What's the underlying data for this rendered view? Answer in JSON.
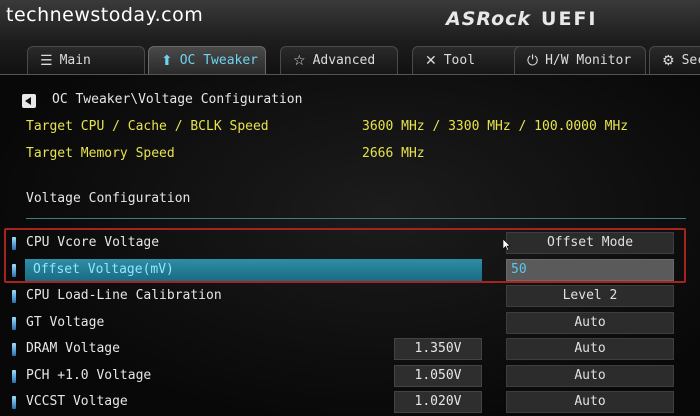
{
  "watermark": "technewstoday.com",
  "brand": {
    "name": "ASRock",
    "product": "UEFI"
  },
  "tabs": [
    {
      "label": "Main",
      "icon": "list-icon",
      "active": false
    },
    {
      "label": "OC Tweaker",
      "icon": "rocket-icon",
      "active": true
    },
    {
      "label": "Advanced",
      "icon": "star-icon",
      "active": false
    },
    {
      "label": "Tool",
      "icon": "tools-icon",
      "active": false
    },
    {
      "label": "H/W Monitor",
      "icon": "power-icon",
      "active": false
    },
    {
      "label": "Secu",
      "icon": "lock-icon",
      "active": false
    }
  ],
  "breadcrumb": "OC Tweaker\\Voltage Configuration",
  "info": [
    {
      "label": "Target CPU / Cache / BCLK Speed",
      "value": "3600 MHz / 3300 MHz / 100.0000 MHz"
    },
    {
      "label": "Target Memory Speed",
      "value": "2666 MHz"
    }
  ],
  "section_title": "Voltage Configuration",
  "settings": [
    {
      "label": "CPU Vcore Voltage",
      "value": "Offset Mode",
      "voltage": ""
    },
    {
      "label": "Offset Voltage(mV)",
      "value": "50",
      "voltage": ""
    },
    {
      "label": "CPU Load-Line Calibration",
      "value": "Level 2",
      "voltage": ""
    },
    {
      "label": "GT Voltage",
      "value": "Auto",
      "voltage": ""
    },
    {
      "label": "DRAM Voltage",
      "value": "Auto",
      "voltage": "1.350V"
    },
    {
      "label": "PCH +1.0 Voltage",
      "value": "Auto",
      "voltage": "1.050V"
    },
    {
      "label": "VCCST Voltage",
      "value": "Auto",
      "voltage": "1.020V"
    }
  ],
  "colors": {
    "accent": "#6fd2f0",
    "info_text": "#e7e34a",
    "highlight_frame": "#a8221e",
    "selection": "#2e8ea6"
  }
}
